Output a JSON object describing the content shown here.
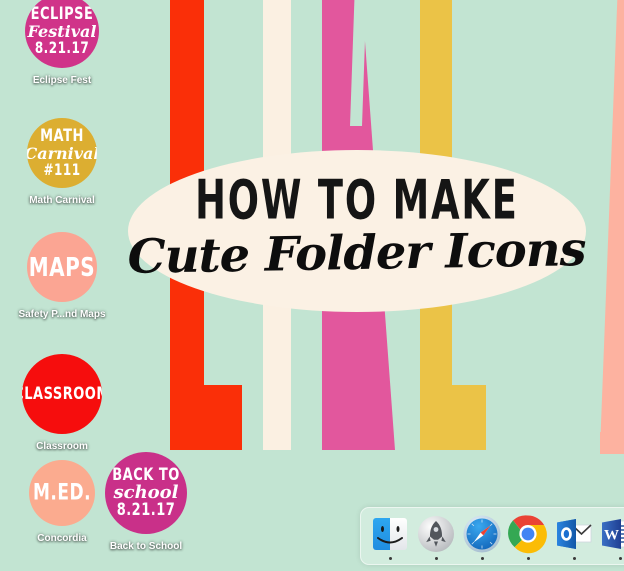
{
  "desktop": {
    "wallpaper": {
      "background_color": "#c2e4d2",
      "letters": [
        {
          "glyph": "L",
          "color": "#fa2f08"
        },
        {
          "glyph": "I",
          "color": "#fbf0e2"
        },
        {
          "glyph": "V",
          "color": "#e2579d"
        },
        {
          "glyph": "L",
          "color": "#ebc347"
        },
        {
          "glyph": "A",
          "color": "#fdb2a0"
        }
      ],
      "banner": {
        "background_color": "#fbf1e4",
        "line1": "HOW TO MAKE",
        "line2": "Cute Folder Icons"
      }
    },
    "icons": [
      {
        "label": "Eclipse Fest",
        "circle_color": "#d03389",
        "art_lines": [
          "ECLIPSE",
          "Festival",
          "8.21.17"
        ]
      },
      {
        "label": "Math Carnival",
        "circle_color": "#dcae31",
        "art_lines": [
          "MATH",
          "Carnival",
          "#111"
        ]
      },
      {
        "label": "Safety P...nd Maps",
        "circle_color": "#fba593",
        "art_lines": [
          "MAPS"
        ]
      },
      {
        "label": "Classroom",
        "circle_color": "#f60d0d",
        "art_lines": [
          "CLASSROOM"
        ]
      },
      {
        "label": "Concordia",
        "circle_color": "#fbab8f",
        "art_lines": [
          "M.ED."
        ]
      },
      {
        "label": "Back to School",
        "circle_color": "#c93089",
        "art_lines": [
          "BACK TO",
          "school",
          "8.21.17"
        ]
      }
    ]
  },
  "dock": {
    "items": [
      {
        "name": "Finder",
        "icon": "finder-icon",
        "running": true
      },
      {
        "name": "Launchpad",
        "icon": "launchpad-icon",
        "running": true
      },
      {
        "name": "Safari",
        "icon": "safari-icon",
        "running": true
      },
      {
        "name": "Google Chrome",
        "icon": "chrome-icon",
        "running": true
      },
      {
        "name": "Microsoft Outlook",
        "icon": "outlook-icon",
        "running": true
      },
      {
        "name": "Microsoft Word",
        "icon": "word-icon",
        "running": true
      }
    ]
  }
}
